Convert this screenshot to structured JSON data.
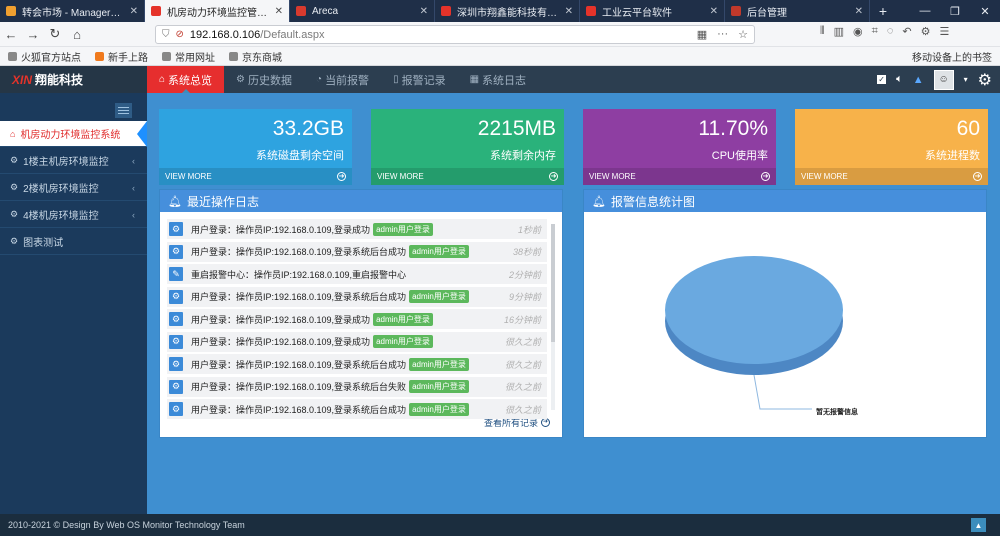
{
  "browser": {
    "tabs": [
      {
        "title": "转会市场 - ManagerZone",
        "color": "#f0a030",
        "active": false
      },
      {
        "title": "机房动力环境监控管理系统",
        "color": "#e5332a",
        "active": true
      },
      {
        "title": "Areca",
        "color": "#d93a2e",
        "active": false
      },
      {
        "title": "深圳市翔鑫能科技有限公司",
        "color": "#e5332a",
        "active": false
      },
      {
        "title": "工业云平台软件",
        "color": "#e5332a",
        "active": false
      },
      {
        "title": "后台管理",
        "color": "#c0392b",
        "active": false
      }
    ],
    "new_tab_label": "+",
    "url_host": "192.168.0.106",
    "url_path": "/Default.aspx",
    "bookmarks": [
      {
        "label": "火狐官方站点",
        "color": "#888888"
      },
      {
        "label": "新手上路",
        "color": "#f07a1e"
      },
      {
        "label": "常用网址",
        "color": "#888888"
      },
      {
        "label": "京东商城",
        "color": "#888888"
      }
    ],
    "mobile_bookmarks": "移动设备上的书签"
  },
  "header": {
    "logo_mark": "XIN",
    "logo_text": "翔能科技",
    "menu": [
      {
        "label": "系统总览",
        "icon": "home-icon",
        "glyph": "⌂",
        "active": true
      },
      {
        "label": "历史数据",
        "icon": "cogs-icon",
        "glyph": "⚙",
        "active": false
      },
      {
        "label": "当前报警",
        "icon": "clock-icon",
        "glyph": "◔",
        "active": false
      },
      {
        "label": "报警记录",
        "icon": "bookmark-icon",
        "glyph": "▯",
        "active": false
      },
      {
        "label": "系统日志",
        "icon": "table-icon",
        "glyph": "▦",
        "active": false
      }
    ]
  },
  "sidebar": {
    "items": [
      {
        "label": "机房动力环境监控系统",
        "active": true,
        "arrow": false
      },
      {
        "label": "1楼主机房环境监控",
        "active": false,
        "arrow": true
      },
      {
        "label": "2楼机房环境监控",
        "active": false,
        "arrow": true
      },
      {
        "label": "4楼机房环境监控",
        "active": false,
        "arrow": true
      },
      {
        "label": "图表测试",
        "active": false,
        "arrow": false
      }
    ]
  },
  "stats": [
    {
      "value": "33.2GB",
      "label": "系统磁盘剩余空间",
      "more": "VIEW MORE",
      "color": "#2ea3e0"
    },
    {
      "value": "2215MB",
      "label": "系统剩余内存",
      "more": "VIEW MORE",
      "color": "#2ab27b"
    },
    {
      "value": "11.70%",
      "label": "CPU使用率",
      "more": "VIEW MORE",
      "color": "#8e3ea2"
    },
    {
      "value": "60",
      "label": "系统进程数",
      "more": "VIEW MORE",
      "color": "#f7b24a"
    }
  ],
  "log_panel": {
    "title": "最近操作日志",
    "see_all": "查看所有记录",
    "rows": [
      {
        "icon": "cogs-icon",
        "text": "用户登录：操作员IP:192.168.0.109,登录成功",
        "tag": "admin用户登录",
        "time": "1秒前"
      },
      {
        "icon": "cogs-icon",
        "text": "用户登录：操作员IP:192.168.0.109,登录系统后台成功",
        "tag": "admin用户登录",
        "time": "38秒前"
      },
      {
        "icon": "pencil-icon",
        "text": "重启报警中心：操作员IP:192.168.0.109,重启报警中心",
        "tag": "",
        "time": "2分钟前"
      },
      {
        "icon": "cogs-icon",
        "text": "用户登录：操作员IP:192.168.0.109,登录系统后台成功",
        "tag": "admin用户登录",
        "time": "9分钟前"
      },
      {
        "icon": "cogs-icon",
        "text": "用户登录：操作员IP:192.168.0.109,登录成功",
        "tag": "admin用户登录",
        "time": "16分钟前"
      },
      {
        "icon": "cogs-icon",
        "text": "用户登录：操作员IP:192.168.0.109,登录成功",
        "tag": "admin用户登录",
        "time": "很久之前"
      },
      {
        "icon": "cogs-icon",
        "text": "用户登录：操作员IP:192.168.0.109,登录系统后台成功",
        "tag": "admin用户登录",
        "time": "很久之前"
      },
      {
        "icon": "cogs-icon",
        "text": "用户登录：操作员IP:192.168.0.109,登录系统后台失败",
        "tag": "admin用户登录",
        "time": "很久之前"
      },
      {
        "icon": "cogs-icon",
        "text": "用户登录：操作员IP:192.168.0.109,登录系统后台成功",
        "tag": "admin用户登录",
        "time": "很久之前"
      }
    ]
  },
  "alarm_panel": {
    "title": "报警信息统计图",
    "pie_label": "暂无报警信息",
    "pie_color": "#6aa9e0"
  },
  "footer": {
    "text": "2010-2021 © Design By Web OS Monitor Technology Team"
  }
}
